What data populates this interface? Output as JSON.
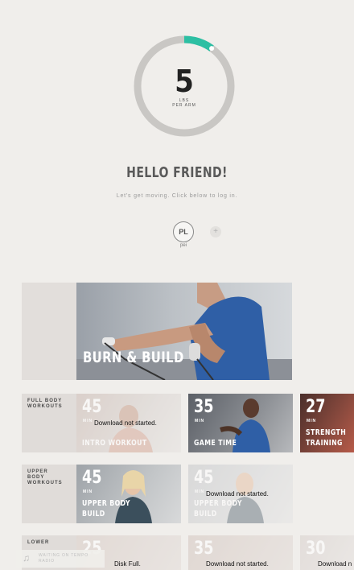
{
  "hero": {
    "weight_value": "5",
    "weight_unit": "LBS\nPER ARM",
    "progress": 0.1,
    "accent_color": "#2dbfa3"
  },
  "greeting": "HELLO FRIEND!",
  "subtitle": "Let's get moving. Click below to log in.",
  "profile": {
    "initials": "PL",
    "name": "pei",
    "add_label": "+"
  },
  "featured": {
    "title": "BURN & BUILD"
  },
  "rows": [
    {
      "label": "FULL BODY\nWORKOUTS",
      "cards": [
        {
          "minutes": "45",
          "unit": "MIN",
          "title": "INTRO WORKOUT",
          "status": "Download not started."
        },
        {
          "minutes": "35",
          "unit": "MIN",
          "title": "GAME TIME",
          "status": ""
        },
        {
          "minutes": "27",
          "unit": "MIN",
          "title": "STRENGTH\nTRAINING",
          "status": ""
        }
      ]
    },
    {
      "label": "UPPER\nBODY\nWORKOUTS",
      "cards": [
        {
          "minutes": "45",
          "unit": "MIN",
          "title": "UPPER BODY\nBUILD",
          "status": ""
        },
        {
          "minutes": "45",
          "unit": "MIN",
          "title": "UPPER BODY\nBUILD",
          "status": "Download not started."
        }
      ]
    },
    {
      "label": "LOWER",
      "cards": [
        {
          "minutes": "25",
          "unit": "",
          "title": "",
          "status": "Disk Full."
        },
        {
          "minutes": "35",
          "unit": "",
          "title": "",
          "status": "Download not started."
        },
        {
          "minutes": "30",
          "unit": "",
          "title": "",
          "status": "Download n"
        }
      ]
    }
  ],
  "player": {
    "text": "WAITING ON TEMPO RADIO"
  }
}
